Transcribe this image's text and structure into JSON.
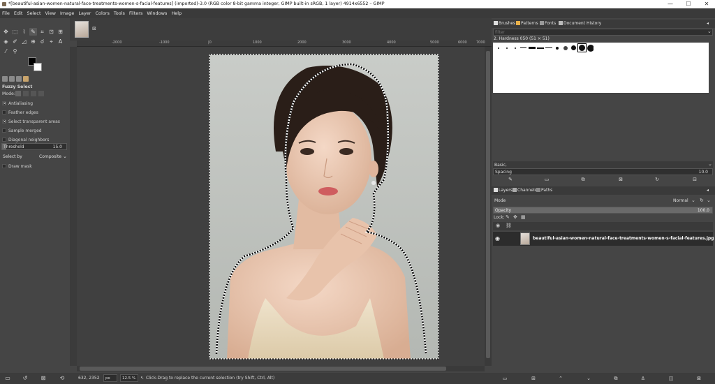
{
  "window": {
    "title": "*[beautiful-asian-women-natural-face-treatments-women-s-facial-features] (imported)-3.0 (RGB color 8-bit gamma integer, GIMP built-in sRGB, 1 layer) 4914x6552 – GIMP",
    "minimize": "—",
    "maximize": "☐",
    "close": "✕"
  },
  "menu": [
    "File",
    "Edit",
    "Select",
    "View",
    "Image",
    "Layer",
    "Colors",
    "Tools",
    "Filters",
    "Windows",
    "Help"
  ],
  "tool_options": {
    "title": "Fuzzy Select",
    "mode_label": "Mode:",
    "options": [
      {
        "label": "Antialiasing",
        "checked": true
      },
      {
        "label": "Feather edges",
        "checked": false
      },
      {
        "label": "Select transparent areas",
        "checked": true
      },
      {
        "label": "Sample merged",
        "checked": false
      },
      {
        "label": "Diagonal neighbors",
        "checked": false
      }
    ],
    "threshold_label": "Threshold",
    "threshold_value": "15.0",
    "threshold_fraction": 0.06,
    "select_by_label": "Select by",
    "select_by_value": "Composite",
    "draw_mask_label": "Draw mask"
  },
  "ruler": {
    "labels": [
      "-2000",
      "-1000",
      "|0",
      "1000",
      "2000",
      "3000",
      "4000",
      "5000",
      "6000",
      "7000"
    ]
  },
  "status": {
    "coords": "632, 2352",
    "unit": "px",
    "zoom": "12.5 %",
    "message": "Click-Drag to replace the current selection (try Shift, Ctrl, Alt)"
  },
  "brushes_panel": {
    "tabs": [
      "Brushes",
      "Patterns",
      "Fonts",
      "Document History"
    ],
    "filter_placeholder": "filter",
    "brush_name": "2. Hardness 050 (51 × 51)",
    "preset": "Basic,",
    "spacing_label": "Spacing",
    "spacing_value": "10.0"
  },
  "layers_panel": {
    "tabs": [
      "Layers",
      "Channels",
      "Paths"
    ],
    "mode_label": "Mode",
    "mode_value": "Normal",
    "opacity_label": "Opacity",
    "opacity_value": "100.0",
    "lock_label": "Lock:",
    "layer_name": "beautiful-asian-women-natural-face-treatments-women-s-facial-features.jpg"
  },
  "colors": {
    "background": "#454545",
    "panel_dark": "#3a3a3a",
    "foreground_swatch": "#000000",
    "background_swatch": "#ffffff"
  }
}
